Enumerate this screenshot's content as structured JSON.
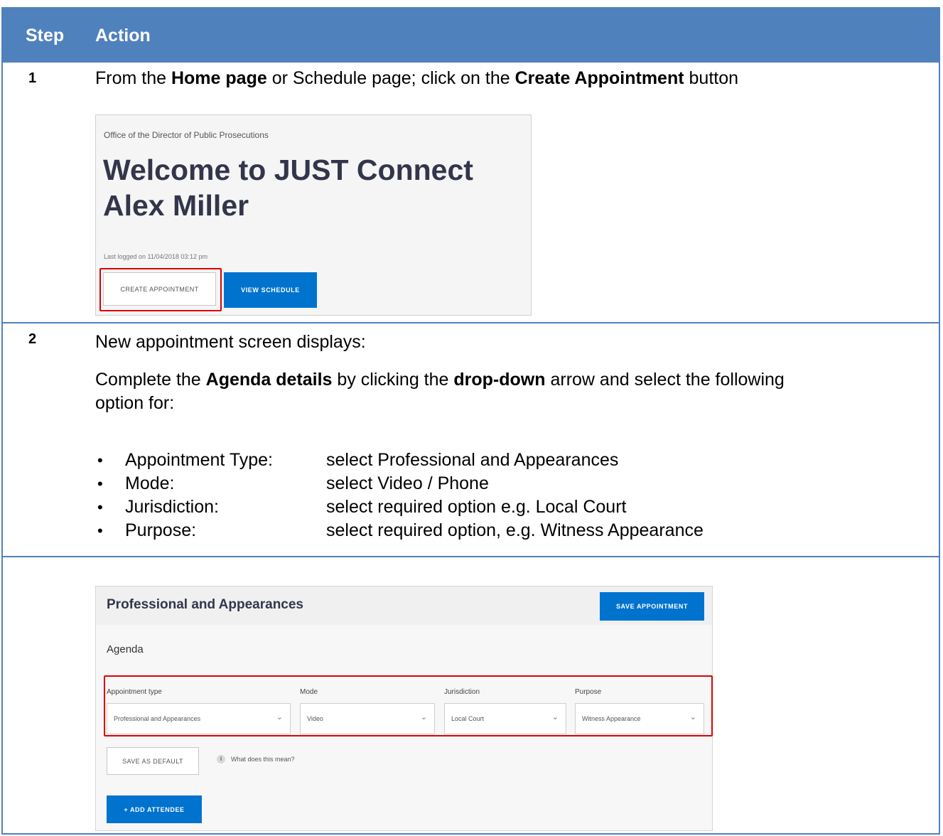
{
  "header": {
    "step": "Step",
    "action": "Action"
  },
  "step1": {
    "number": "1",
    "text_prefix": "From the ",
    "text_b1": "Home page",
    "text_mid": " or Schedule page; click on the ",
    "text_b2": "Create Appointment",
    "text_suffix": " button",
    "screenshot": {
      "org": "Office of the Director of Public Prosecutions",
      "welcome_line1": "Welcome to JUST Connect",
      "welcome_line2": "Alex Miller",
      "logged": "Last logged on 11/04/2018 03:12 pm",
      "create_button": "CREATE APPOINTMENT",
      "view_button": "VIEW SCHEDULE"
    }
  },
  "step2": {
    "number": "2",
    "intro": "New appointment screen displays:",
    "para_prefix": "Complete the ",
    "para_b1": "Agenda details",
    "para_mid": " by clicking the ",
    "para_b2": "drop-down",
    "para_suffix_line1": " arrow and select the following",
    "para_line2": "option for:",
    "bullets": [
      {
        "label": "Appointment Type:",
        "value": "select Professional and Appearances"
      },
      {
        "label": "Mode:",
        "value": "select Video / Phone"
      },
      {
        "label": "Jurisdiction:",
        "value": "select required option e.g. Local Court"
      },
      {
        "label": "Purpose:",
        "value": "select required option, e.g. Witness Appearance"
      }
    ],
    "screenshot": {
      "title": "Professional and Appearances",
      "save_button": "SAVE APPOINTMENT",
      "agenda": "Agenda",
      "fields": [
        {
          "label": "Appointment type",
          "value": "Professional and Appearances"
        },
        {
          "label": "Mode",
          "value": "Video"
        },
        {
          "label": "Jurisdiction",
          "value": "Local Court"
        },
        {
          "label": "Purpose",
          "value": "Witness Appearance"
        }
      ],
      "default_button": "SAVE AS DEFAULT",
      "info_icon": "i",
      "info_text": "What does this mean?",
      "add_attendee": "+ ADD ATTENDEE"
    }
  },
  "icons": {
    "info": "info-icon",
    "chevron": "chevron-down-icon"
  }
}
